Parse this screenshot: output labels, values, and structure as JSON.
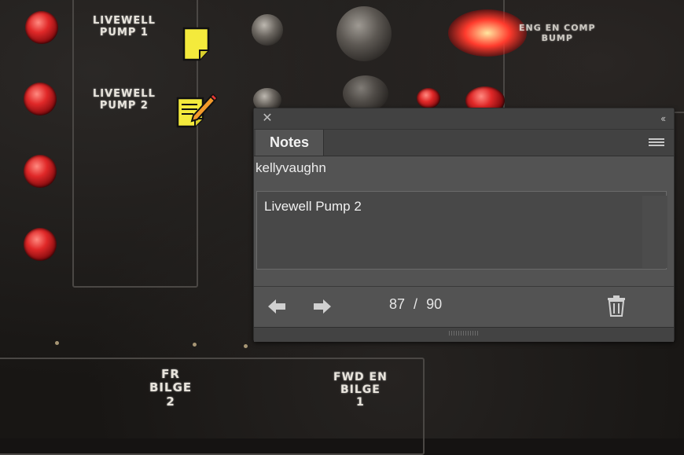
{
  "background": {
    "labels": {
      "pump1": [
        "LIVEWELL",
        "PUMP 1"
      ],
      "pump2": [
        "LIVEWELL",
        "PUMP 2"
      ],
      "fwd_bilge": [
        "FWD EN",
        "BILGE",
        "1"
      ],
      "fr_bilge": [
        "FR",
        "BILGE",
        "2"
      ],
      "eng_bilge": [
        "ENG EN COMP",
        "BUMP"
      ]
    }
  },
  "note_icons": [
    {
      "icon": "sticky-note-icon"
    },
    {
      "icon": "note-editing-icon"
    }
  ],
  "notes_panel": {
    "close_icon": "close-icon",
    "collapse_label": "‹‹",
    "tab_label": "Notes",
    "menu_icon": "panel-menu-icon",
    "author": "kellyvaughn",
    "note_text": "Livewell Pump 2",
    "counter": {
      "current": "87",
      "separator": "/",
      "total": "90"
    },
    "prev_icon": "arrow-left-icon",
    "next_icon": "arrow-right-icon",
    "delete_icon": "trash-icon"
  }
}
